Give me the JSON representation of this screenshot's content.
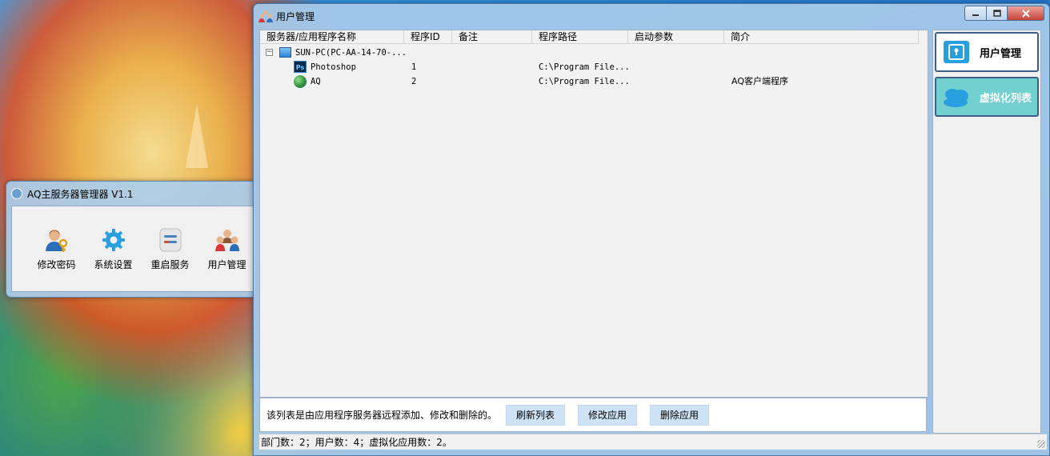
{
  "aq_window": {
    "title": "AQ主服务器管理器 V1.1",
    "tools": [
      {
        "label": "修改密码",
        "icon": "user-key-icon"
      },
      {
        "label": "系统设置",
        "icon": "gear-icon"
      },
      {
        "label": "重启服务",
        "icon": "server-restart-icon"
      },
      {
        "label": "用户管理",
        "icon": "users-icon"
      }
    ]
  },
  "main_window": {
    "title": "用户管理",
    "columns": [
      "服务器/应用程序名称",
      "程序ID",
      "备注",
      "程序路径",
      "启动参数",
      "简介"
    ],
    "tree": {
      "server": "SUN-PC(PC-AA-14-70-...",
      "apps": [
        {
          "name": "Photoshop",
          "id": "1",
          "note": "",
          "path": "C:\\Program File...",
          "args": "",
          "desc": "",
          "icon_text": "Ps"
        },
        {
          "name": "AQ",
          "id": "2",
          "note": "",
          "path": "C:\\Program File...",
          "args": "",
          "desc": "AQ客户端程序"
        }
      ]
    },
    "hint": "该列表是由应用程序服务器远程添加、修改和删除的。",
    "buttons": {
      "refresh": "刷新列表",
      "modify": "修改应用",
      "delete": "删除应用"
    },
    "status": "部门数：2；用户数：4；虚拟化应用数：2。",
    "side_buttons": {
      "user_mgmt": "用户管理",
      "virt_list": "虚拟化列表"
    },
    "expander_symbol": "−"
  },
  "colors": {
    "virt_button": "#72d0d0",
    "action_button": "#cfe3f7",
    "close_button": "#c7443a"
  }
}
